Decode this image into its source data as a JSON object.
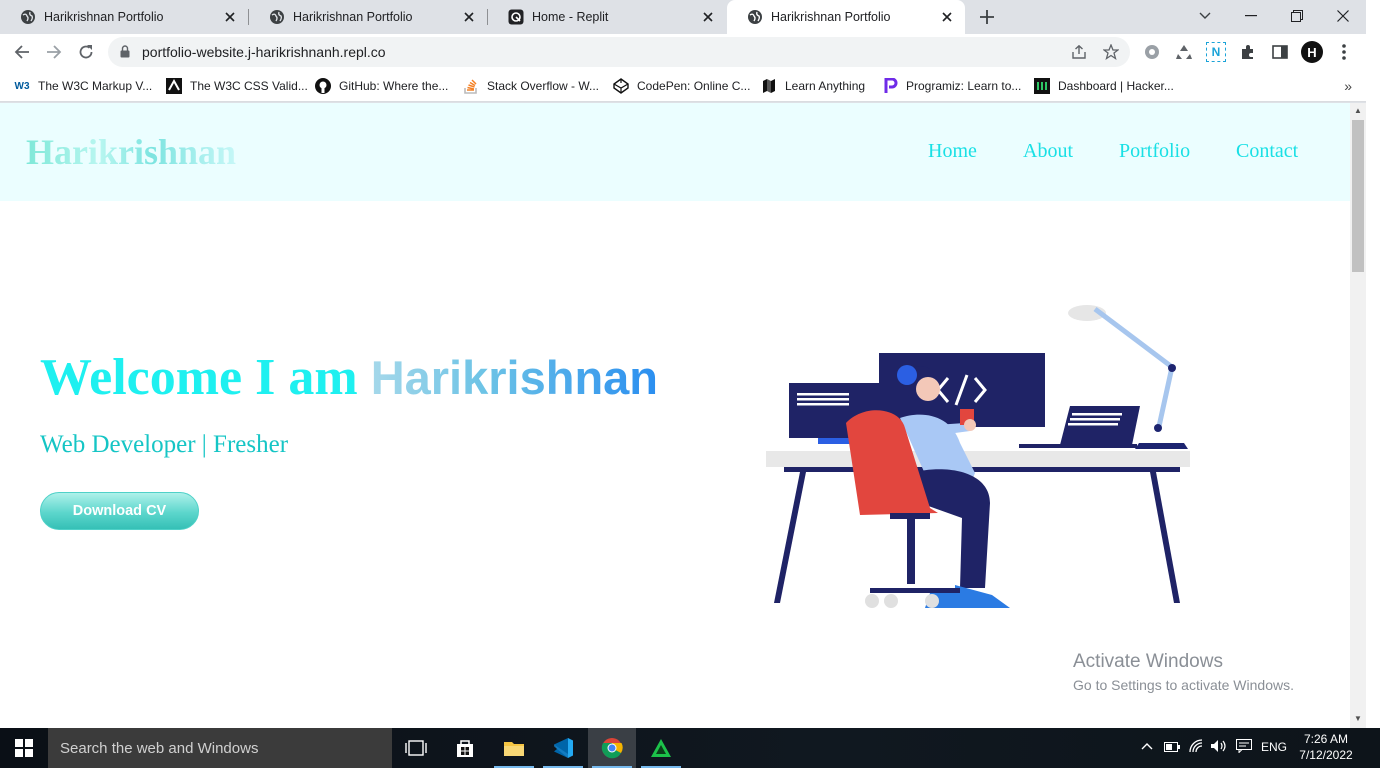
{
  "browser": {
    "tabs": [
      {
        "title": "Harikrishnan Portfolio",
        "icon": "globe-icon",
        "active": false
      },
      {
        "title": "Harikrishnan Portfolio",
        "icon": "globe-icon",
        "active": false
      },
      {
        "title": "Home - Replit",
        "icon": "replit-icon",
        "active": false
      },
      {
        "title": "Harikrishnan Portfolio",
        "icon": "globe-icon",
        "active": true
      }
    ],
    "url": "portfolio-website.j-harikrishnanh.repl.co",
    "profile_initial": "H",
    "extension_badge": "N",
    "bookmarks": [
      {
        "label": "The W3C Markup V...",
        "icon": "w3c-icon"
      },
      {
        "label": "The W3C CSS Valid...",
        "icon": "css-validator-icon"
      },
      {
        "label": "GitHub: Where the...",
        "icon": "github-icon"
      },
      {
        "label": "Stack Overflow - W...",
        "icon": "stackoverflow-icon"
      },
      {
        "label": "CodePen: Online C...",
        "icon": "codepen-icon"
      },
      {
        "label": "Learn Anything",
        "icon": "map-icon"
      },
      {
        "label": "Programiz: Learn to...",
        "icon": "programiz-icon"
      },
      {
        "label": "Dashboard | Hacker...",
        "icon": "hackerrank-icon"
      }
    ],
    "bookmarks_more": "»"
  },
  "site": {
    "logo": "Harikrishnan",
    "nav": [
      "Home",
      "About",
      "Portfolio",
      "Contact"
    ],
    "hero": {
      "greeting": "Welcome I am ",
      "name": "Harikrishnan",
      "subtitle": "Web Developer | Fresher",
      "button": "Download CV"
    },
    "illustration": "developer-at-desk-illustration"
  },
  "watermark": {
    "line1": "Activate Windows",
    "line2": "Go to Settings to activate Windows."
  },
  "taskbar": {
    "search_placeholder": "Search the web and Windows",
    "language": "ENG",
    "time": "7:26 AM",
    "date": "7/12/2022"
  },
  "colors": {
    "accent_cyan": "#1ef0f0",
    "header_bg": "#ebfeff",
    "name_blue": "#2a8ef0",
    "button_teal": "#35c0b6"
  }
}
